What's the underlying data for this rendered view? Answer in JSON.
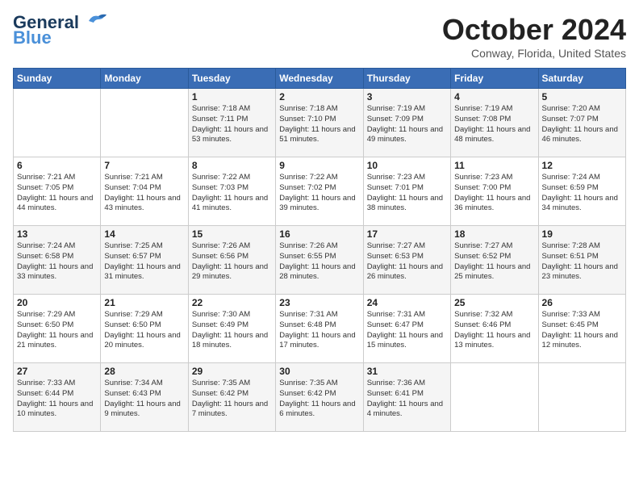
{
  "logo": {
    "line1": "General",
    "line2": "Blue"
  },
  "title": "October 2024",
  "location": "Conway, Florida, United States",
  "days_header": [
    "Sunday",
    "Monday",
    "Tuesday",
    "Wednesday",
    "Thursday",
    "Friday",
    "Saturday"
  ],
  "weeks": [
    [
      {
        "day": "",
        "content": ""
      },
      {
        "day": "",
        "content": ""
      },
      {
        "day": "1",
        "content": "Sunrise: 7:18 AM\nSunset: 7:11 PM\nDaylight: 11 hours and 53 minutes."
      },
      {
        "day": "2",
        "content": "Sunrise: 7:18 AM\nSunset: 7:10 PM\nDaylight: 11 hours and 51 minutes."
      },
      {
        "day": "3",
        "content": "Sunrise: 7:19 AM\nSunset: 7:09 PM\nDaylight: 11 hours and 49 minutes."
      },
      {
        "day": "4",
        "content": "Sunrise: 7:19 AM\nSunset: 7:08 PM\nDaylight: 11 hours and 48 minutes."
      },
      {
        "day": "5",
        "content": "Sunrise: 7:20 AM\nSunset: 7:07 PM\nDaylight: 11 hours and 46 minutes."
      }
    ],
    [
      {
        "day": "6",
        "content": "Sunrise: 7:21 AM\nSunset: 7:05 PM\nDaylight: 11 hours and 44 minutes."
      },
      {
        "day": "7",
        "content": "Sunrise: 7:21 AM\nSunset: 7:04 PM\nDaylight: 11 hours and 43 minutes."
      },
      {
        "day": "8",
        "content": "Sunrise: 7:22 AM\nSunset: 7:03 PM\nDaylight: 11 hours and 41 minutes."
      },
      {
        "day": "9",
        "content": "Sunrise: 7:22 AM\nSunset: 7:02 PM\nDaylight: 11 hours and 39 minutes."
      },
      {
        "day": "10",
        "content": "Sunrise: 7:23 AM\nSunset: 7:01 PM\nDaylight: 11 hours and 38 minutes."
      },
      {
        "day": "11",
        "content": "Sunrise: 7:23 AM\nSunset: 7:00 PM\nDaylight: 11 hours and 36 minutes."
      },
      {
        "day": "12",
        "content": "Sunrise: 7:24 AM\nSunset: 6:59 PM\nDaylight: 11 hours and 34 minutes."
      }
    ],
    [
      {
        "day": "13",
        "content": "Sunrise: 7:24 AM\nSunset: 6:58 PM\nDaylight: 11 hours and 33 minutes."
      },
      {
        "day": "14",
        "content": "Sunrise: 7:25 AM\nSunset: 6:57 PM\nDaylight: 11 hours and 31 minutes."
      },
      {
        "day": "15",
        "content": "Sunrise: 7:26 AM\nSunset: 6:56 PM\nDaylight: 11 hours and 29 minutes."
      },
      {
        "day": "16",
        "content": "Sunrise: 7:26 AM\nSunset: 6:55 PM\nDaylight: 11 hours and 28 minutes."
      },
      {
        "day": "17",
        "content": "Sunrise: 7:27 AM\nSunset: 6:53 PM\nDaylight: 11 hours and 26 minutes."
      },
      {
        "day": "18",
        "content": "Sunrise: 7:27 AM\nSunset: 6:52 PM\nDaylight: 11 hours and 25 minutes."
      },
      {
        "day": "19",
        "content": "Sunrise: 7:28 AM\nSunset: 6:51 PM\nDaylight: 11 hours and 23 minutes."
      }
    ],
    [
      {
        "day": "20",
        "content": "Sunrise: 7:29 AM\nSunset: 6:50 PM\nDaylight: 11 hours and 21 minutes."
      },
      {
        "day": "21",
        "content": "Sunrise: 7:29 AM\nSunset: 6:50 PM\nDaylight: 11 hours and 20 minutes."
      },
      {
        "day": "22",
        "content": "Sunrise: 7:30 AM\nSunset: 6:49 PM\nDaylight: 11 hours and 18 minutes."
      },
      {
        "day": "23",
        "content": "Sunrise: 7:31 AM\nSunset: 6:48 PM\nDaylight: 11 hours and 17 minutes."
      },
      {
        "day": "24",
        "content": "Sunrise: 7:31 AM\nSunset: 6:47 PM\nDaylight: 11 hours and 15 minutes."
      },
      {
        "day": "25",
        "content": "Sunrise: 7:32 AM\nSunset: 6:46 PM\nDaylight: 11 hours and 13 minutes."
      },
      {
        "day": "26",
        "content": "Sunrise: 7:33 AM\nSunset: 6:45 PM\nDaylight: 11 hours and 12 minutes."
      }
    ],
    [
      {
        "day": "27",
        "content": "Sunrise: 7:33 AM\nSunset: 6:44 PM\nDaylight: 11 hours and 10 minutes."
      },
      {
        "day": "28",
        "content": "Sunrise: 7:34 AM\nSunset: 6:43 PM\nDaylight: 11 hours and 9 minutes."
      },
      {
        "day": "29",
        "content": "Sunrise: 7:35 AM\nSunset: 6:42 PM\nDaylight: 11 hours and 7 minutes."
      },
      {
        "day": "30",
        "content": "Sunrise: 7:35 AM\nSunset: 6:42 PM\nDaylight: 11 hours and 6 minutes."
      },
      {
        "day": "31",
        "content": "Sunrise: 7:36 AM\nSunset: 6:41 PM\nDaylight: 11 hours and 4 minutes."
      },
      {
        "day": "",
        "content": ""
      },
      {
        "day": "",
        "content": ""
      }
    ]
  ]
}
